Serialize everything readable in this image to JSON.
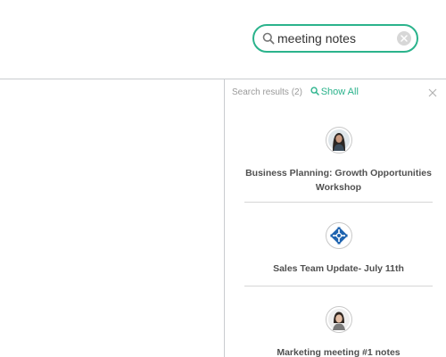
{
  "search": {
    "value": "meeting notes",
    "icon": "search-icon",
    "clear_icon": "clear-icon"
  },
  "results_panel": {
    "count_label": "Search results (2)",
    "show_all_label": "Show All",
    "accent_color": "#2bb38c",
    "items": [
      {
        "title": "Business Planning: Growth Opportunities Workshop",
        "avatar": "person-avatar"
      },
      {
        "title": "Sales Team Update- July 11th",
        "avatar": "team-logo-avatar"
      },
      {
        "title": "Marketing meeting #1 notes",
        "avatar": "person-avatar"
      }
    ]
  }
}
